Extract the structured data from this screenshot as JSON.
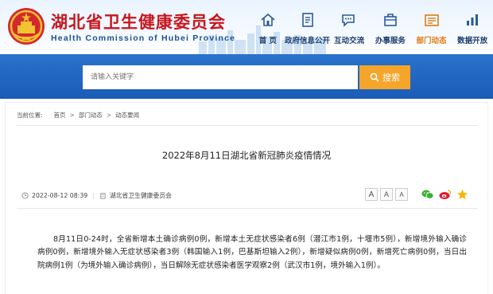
{
  "header": {
    "title": "湖北省卫生健康委员会",
    "subtitle": "Health Commission of Hubei Province"
  },
  "nav": [
    {
      "label": "首 页",
      "icon": "home-icon"
    },
    {
      "label": "政府信息公开",
      "icon": "document-icon"
    },
    {
      "label": "互动交流",
      "icon": "chat-icon"
    },
    {
      "label": "办事服务",
      "icon": "service-icon"
    },
    {
      "label": "部门动态",
      "icon": "news-icon",
      "active": true
    },
    {
      "label": "数据开放",
      "icon": "data-icon"
    }
  ],
  "search": {
    "placeholder": "请输入关键字",
    "button_label": "搜索"
  },
  "breadcrumb": {
    "prefix": "当前位置:",
    "items": [
      "首页",
      "部门动态",
      "动态要闻"
    ]
  },
  "article": {
    "title": "2022年8月11日湖北省新冠肺炎疫情情况",
    "date": "2022-08-12 08:39",
    "source": "湖北省卫生健康委员会",
    "font_sizes": [
      "A",
      "A",
      "A"
    ],
    "share_icons": [
      "wechat-icon",
      "weibo-icon",
      "favorite-star-icon"
    ],
    "body": "8月11日0-24时，全省新增本土确诊病例0例，新增本土无症状感染者6例（潜江市1例，十堰市5例），新增境外输入确诊病例0例，新增境外输入无症状感染者3例（韩国输入1例，巴基斯坦输入2例），新增疑似病例0例，新增死亡病例0例，当日出院病例1例（为境外输入确诊病例），当日解除无症状感染者医学观察2例（武汉市1例，境外输入1例）。"
  },
  "colors": {
    "brand_red": "#c8161d",
    "brand_blue": "#1c4f93",
    "search_band": "#1e63c0",
    "search_button": "#f4a52a",
    "nav_active": "#e07a10"
  }
}
